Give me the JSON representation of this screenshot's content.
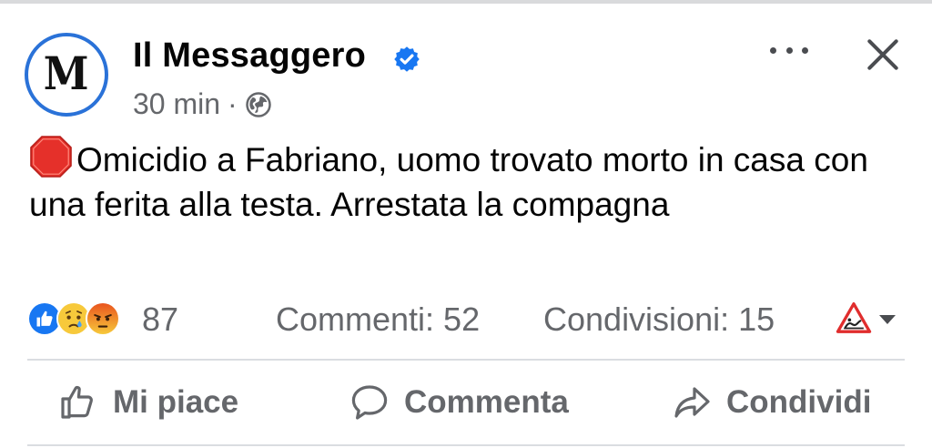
{
  "post": {
    "page_name": "Il Messaggero",
    "avatar_letter": "M",
    "verified": true,
    "time": "30 min",
    "separator": "·",
    "audience_icon": "globe-icon",
    "text_emoji": "stop-sign-emoji",
    "text": "Omicidio a Fabriano, uomo trovato morto in casa con una ferita alla testa. Arrestata la compagna"
  },
  "stats": {
    "reactions": [
      "like",
      "sad",
      "angry"
    ],
    "reaction_count": "87",
    "comments": "Commenti: 52",
    "shares": "Condivisioni: 15"
  },
  "actions": {
    "like": "Mi piace",
    "comment": "Commenta",
    "share": "Condividi"
  },
  "colors": {
    "verified": "#1877f2",
    "avatar_ring": "#2a72d8",
    "secondary_text": "#65676b"
  }
}
